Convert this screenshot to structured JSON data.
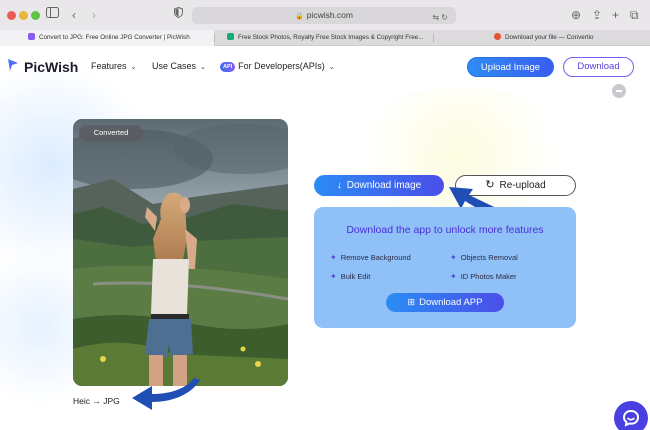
{
  "browser": {
    "address": "picwish.com",
    "tabs": [
      {
        "title": "Convert to JPG: Free Online JPG Converter | PicWish",
        "color": "#8a5cf5"
      },
      {
        "title": "Free Stock Photos, Royalty Free Stock Images & Copyright Free...",
        "color": "#19a974"
      },
      {
        "title": "Download your file — Convertio",
        "color": "#e5532d"
      }
    ]
  },
  "header": {
    "logo": "PicWish",
    "nav": [
      {
        "label": "Features"
      },
      {
        "label": "Use Cases"
      },
      {
        "badge": "API",
        "label": "For Developers(APIs)"
      }
    ],
    "upload_button": "Upload Image",
    "download_button": "Download"
  },
  "result": {
    "converted_badge": "Converted",
    "format_label": "Heic → JPG",
    "download_image_button": "Download image",
    "reupload_button": "Re-upload"
  },
  "app_promo": {
    "title": "Download the app to unlock more features",
    "features": [
      "Remove Background",
      "Objects Removal",
      "Bulk Edit",
      "ID Photos Maker"
    ],
    "button": "Download APP"
  },
  "colors": {
    "brand_purple": "#5b3fe0",
    "brand_blue": "#2b8cf4",
    "panel_blue": "#8fc0f8",
    "arrow_blue": "#1f4fb4"
  }
}
